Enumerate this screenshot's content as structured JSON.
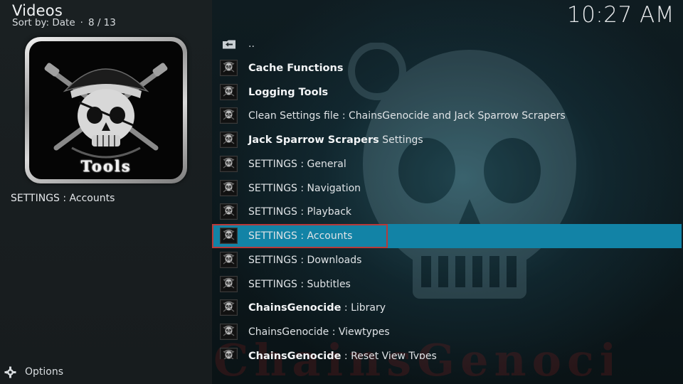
{
  "header": {
    "title": "Videos",
    "sort_label": "Sort by: Date",
    "separator": "·",
    "position": "8 / 13"
  },
  "clock": "10:27 AM",
  "thumbnail": {
    "icon": "pirate-skull",
    "caption": "Tools"
  },
  "selected_caption": "SETTINGS : Accounts",
  "options_label": "Options",
  "watermark": "ChainsGenocide",
  "colors": {
    "focus_bg": "#1283a6",
    "focus_border": "#b73a3a",
    "panel_bg": "#1a2022"
  },
  "list": {
    "parent": "..",
    "items": [
      {
        "bold": "Cache Functions",
        "rest": ""
      },
      {
        "bold": "Logging Tools",
        "rest": ""
      },
      {
        "bold": "",
        "rest": "Clean Settings file : ChainsGenocide and Jack Sparrow Scrapers"
      },
      {
        "bold": "Jack Sparrow Scrapers",
        "rest": " Settings"
      },
      {
        "bold": "",
        "rest": "SETTINGS : General"
      },
      {
        "bold": "",
        "rest": "SETTINGS : Navigation"
      },
      {
        "bold": "",
        "rest": "SETTINGS : Playback"
      },
      {
        "bold": "",
        "rest": "SETTINGS : Accounts",
        "focused": true
      },
      {
        "bold": "",
        "rest": "SETTINGS : Downloads"
      },
      {
        "bold": "",
        "rest": "SETTINGS : Subtitles"
      },
      {
        "bold": "ChainsGenocide",
        "rest": " : Library"
      },
      {
        "bold": "",
        "rest": "ChainsGenocide : Viewtypes"
      },
      {
        "bold": "ChainsGenocide",
        "rest": " : Reset View Types"
      }
    ]
  }
}
